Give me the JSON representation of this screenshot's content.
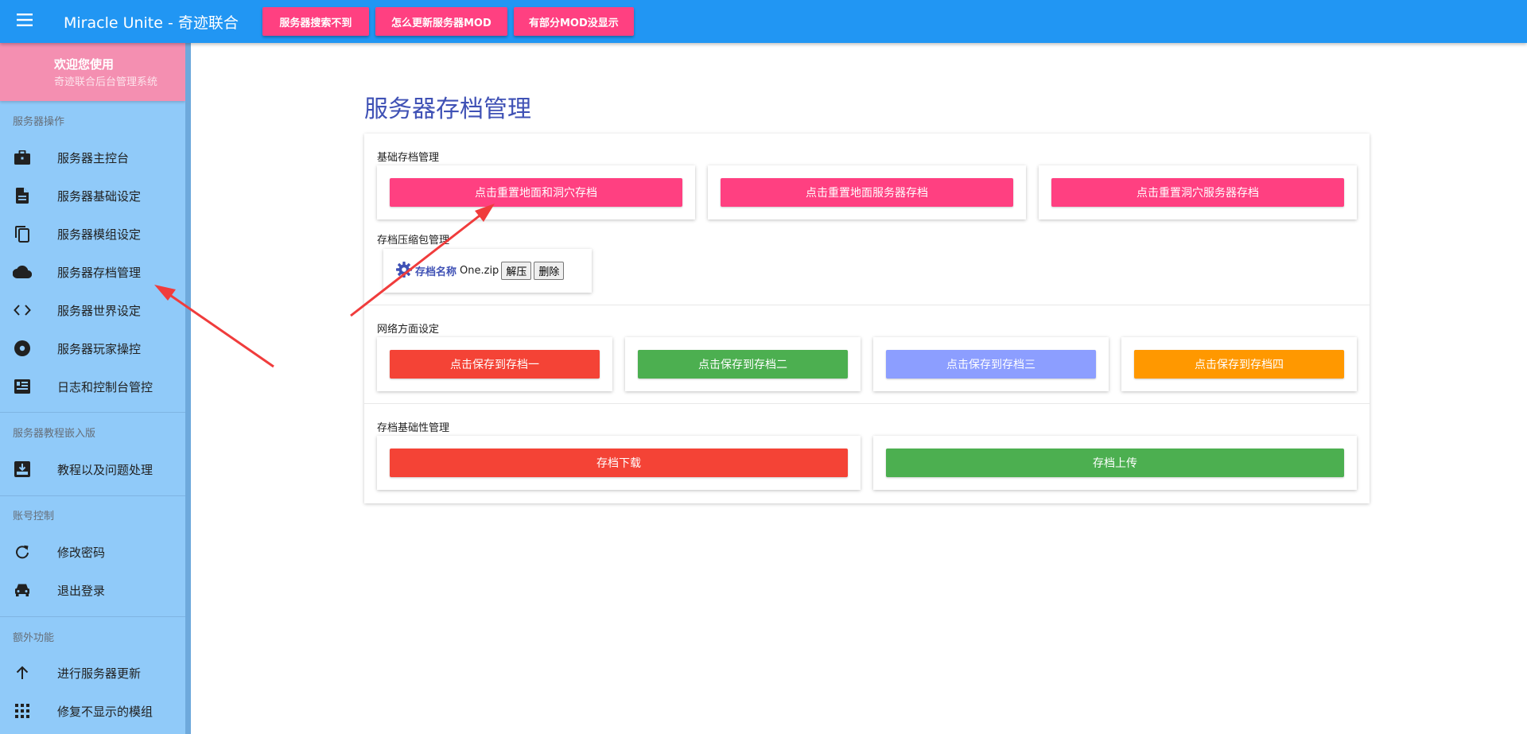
{
  "appbar": {
    "title": "Miracle Unite - 奇迹联合",
    "menu_icon": "menu-icon",
    "buttons": [
      {
        "label": "服务器搜索不到"
      },
      {
        "label": "怎么更新服务器MOD"
      },
      {
        "label": "有部分MOD没显示"
      }
    ]
  },
  "sidebar": {
    "welcome_title": "欢迎您使用",
    "welcome_subtitle": "奇迹联合后台管理系统",
    "sections": [
      {
        "label": "服务器操作",
        "items": [
          {
            "label": "服务器主控台",
            "icon": "briefcase-icon"
          },
          {
            "label": "服务器基础设定",
            "icon": "document-icon"
          },
          {
            "label": "服务器模组设定",
            "icon": "copy-icon"
          },
          {
            "label": "服务器存档管理",
            "icon": "cloud-icon"
          },
          {
            "label": "服务器世界设定",
            "icon": "code-icon"
          },
          {
            "label": "服务器玩家操控",
            "icon": "disc-icon"
          },
          {
            "label": "日志和控制台管控",
            "icon": "dashboard-icon"
          }
        ]
      },
      {
        "label": "服务器教程嵌入版",
        "items": [
          {
            "label": "教程以及问题处理",
            "icon": "download-box-icon"
          }
        ]
      },
      {
        "label": "账号控制",
        "items": [
          {
            "label": "修改密码",
            "icon": "refresh-icon"
          },
          {
            "label": "退出登录",
            "icon": "car-icon"
          }
        ]
      },
      {
        "label": "额外功能",
        "items": [
          {
            "label": "进行服务器更新",
            "icon": "arrow-up-icon"
          },
          {
            "label": "修复不显示的模组",
            "icon": "apps-grid-icon"
          }
        ]
      }
    ]
  },
  "main": {
    "page_title": "服务器存档管理",
    "basic": {
      "label": "基础存档管理",
      "buttons": [
        "点击重置地面和洞穴存档",
        "点击重置地面服务器存档",
        "点击重置洞穴服务器存档"
      ]
    },
    "compress": {
      "label": "存档压缩包管理",
      "icon": "gear-icon",
      "name_label": "存档名称",
      "file": "One.zip",
      "extract_label": "解压",
      "delete_label": "删除"
    },
    "network": {
      "label": "网络方面设定",
      "buttons": [
        "点击保存到存档一",
        "点击保存到存档二",
        "点击保存到存档三",
        "点击保存到存档四"
      ]
    },
    "archive_basic": {
      "label": "存档基础性管理",
      "download_label": "存档下载",
      "upload_label": "存档上传"
    }
  },
  "colors": {
    "appbar": "#2196f3",
    "accent_pink": "#ff4081",
    "sidebar": "#90caf9",
    "welcome": "#f48fb1",
    "title": "#3f51b5",
    "red": "#f44336",
    "green": "#4caf50",
    "periwinkle": "#8c9eff",
    "orange": "#ff9800",
    "annotation_arrow": "#f03c3c"
  }
}
